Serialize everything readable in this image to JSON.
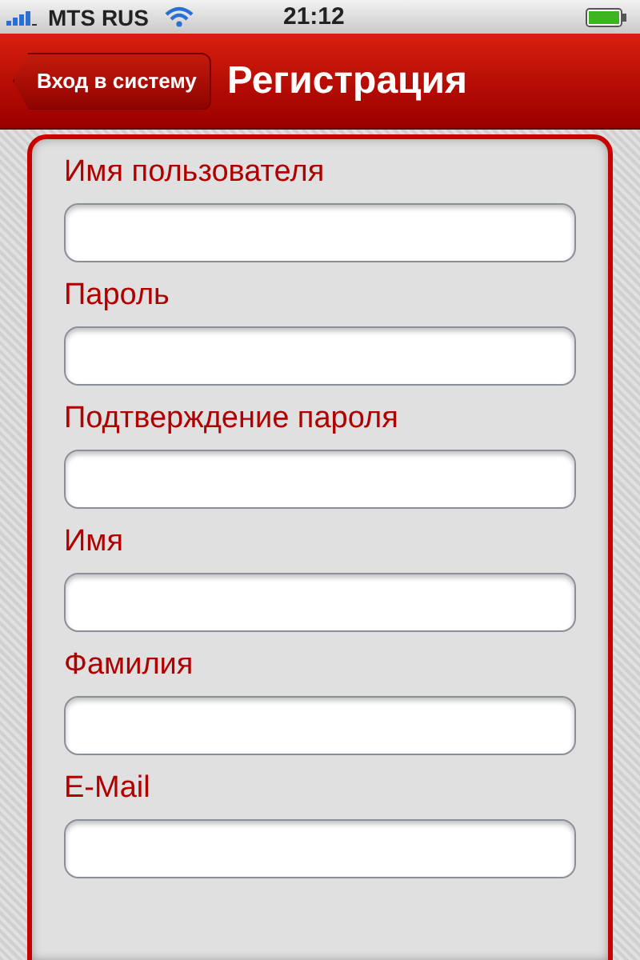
{
  "status_bar": {
    "carrier": "MTS RUS",
    "time": "21:12"
  },
  "nav_bar": {
    "back_button": "Вход в систему",
    "title": "Регистрация"
  },
  "form": {
    "fields": [
      {
        "label": "Имя пользователя"
      },
      {
        "label": "Пароль"
      },
      {
        "label": "Подтверждение пароля"
      },
      {
        "label": "Имя"
      },
      {
        "label": "Фамилия"
      },
      {
        "label": "E-Mail"
      }
    ]
  }
}
